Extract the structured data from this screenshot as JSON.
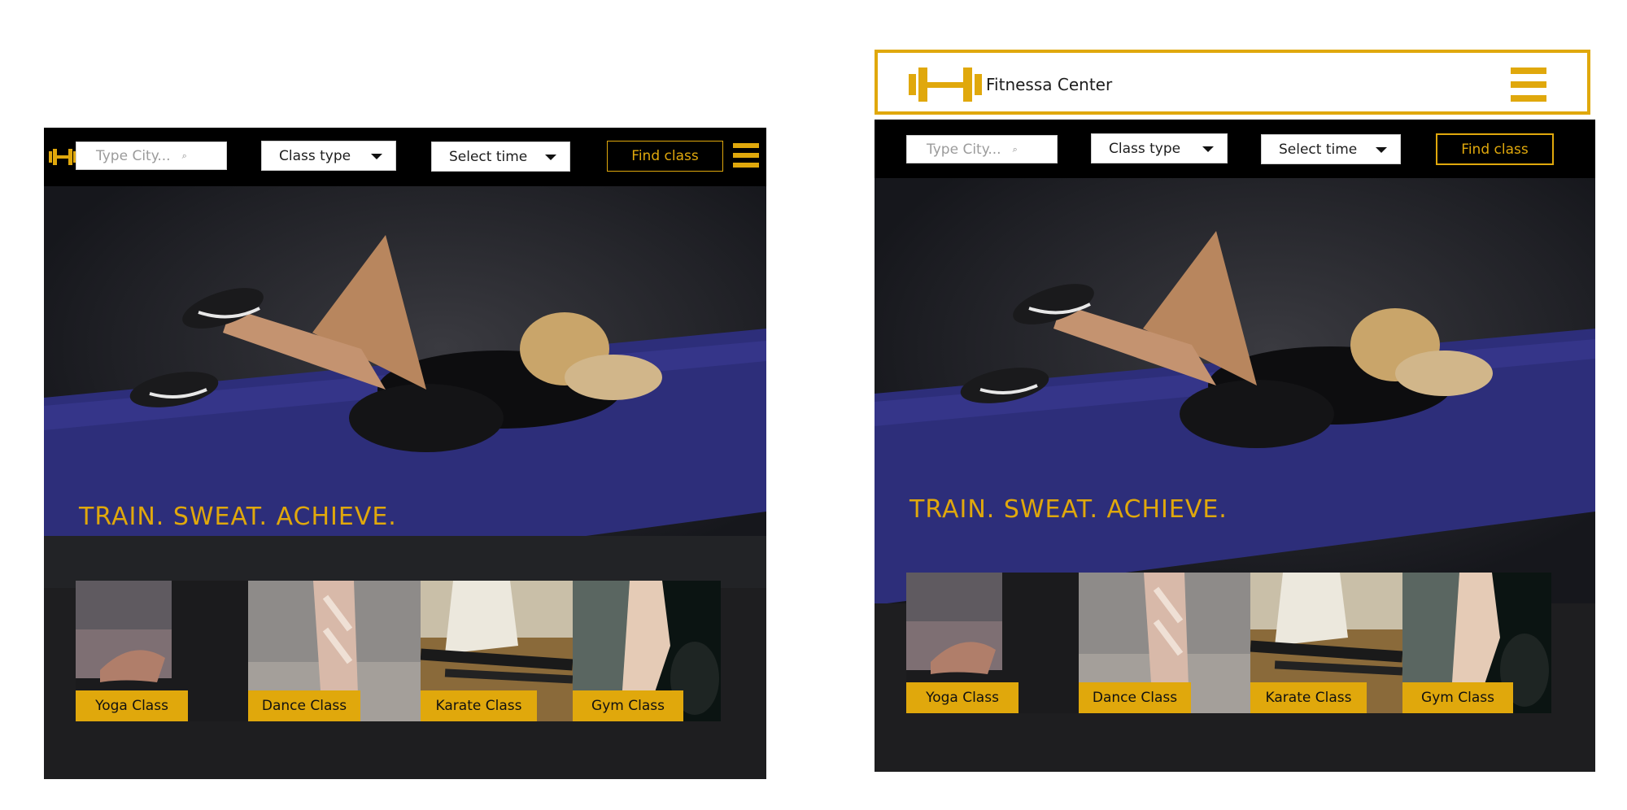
{
  "brand": {
    "name": "Fitnessa Center"
  },
  "search": {
    "city_placeholder": "Type City...",
    "search_glyph": "⌕"
  },
  "filters": {
    "class_type": "Class type",
    "select_time": "Select time"
  },
  "actions": {
    "find_class": "Find class"
  },
  "hero": {
    "tagline": "TRAIN. SWEAT. ACHIEVE."
  },
  "classes": [
    {
      "label": "Yoga Class"
    },
    {
      "label": "Dance Class"
    },
    {
      "label": "Karate Class"
    },
    {
      "label": "Gym Class"
    }
  ],
  "colors": {
    "accent": "#e0a80c",
    "toolbar": "#000000",
    "panel": "#1e1e20",
    "mat": "#2d2e7a"
  },
  "icons": {
    "logo": "dumbbell-icon",
    "menu": "hamburger-menu-icon",
    "search": "search-icon",
    "dropdown": "caret-down-icon"
  }
}
